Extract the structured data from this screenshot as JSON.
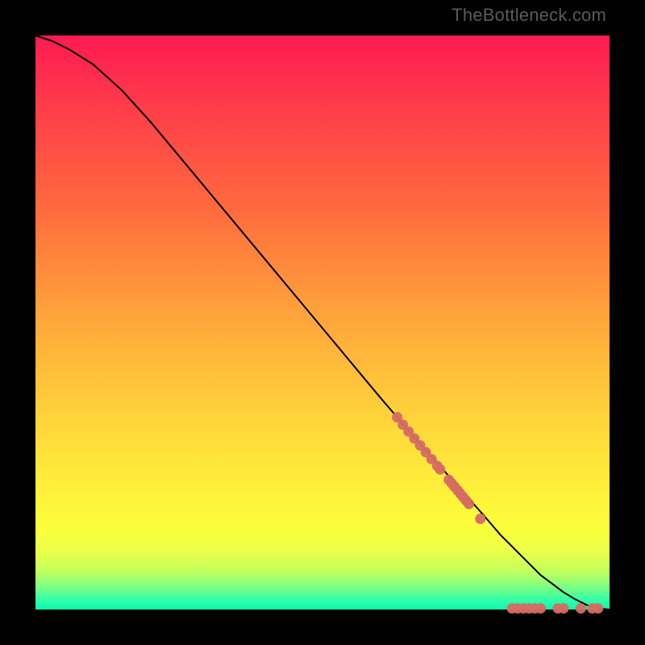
{
  "watermark": "TheBottleneck.com",
  "chart_data": {
    "type": "line",
    "title": "",
    "xlabel": "",
    "ylabel": "",
    "xlim": [
      0,
      100
    ],
    "ylim": [
      0,
      100
    ],
    "series": [
      {
        "name": "curve",
        "x": [
          0,
          3,
          6,
          10,
          15,
          20,
          30,
          40,
          50,
          60,
          66,
          70,
          74,
          78,
          81,
          84,
          86,
          88,
          90,
          92,
          94,
          96,
          98,
          100
        ],
        "y": [
          100,
          99,
          97.5,
          95,
          90.5,
          85,
          73,
          61,
          49,
          37,
          30,
          25.5,
          21,
          16.5,
          13,
          10,
          8,
          6,
          4.5,
          3,
          1.8,
          0.8,
          0.2,
          0
        ]
      }
    ],
    "markers": [
      {
        "x": 63,
        "y": 33.5
      },
      {
        "x": 64,
        "y": 32.2
      },
      {
        "x": 65,
        "y": 31
      },
      {
        "x": 66,
        "y": 29.8
      },
      {
        "x": 67,
        "y": 28.6
      },
      {
        "x": 68,
        "y": 27.4
      },
      {
        "x": 69,
        "y": 26.2
      },
      {
        "x": 70,
        "y": 25.0
      },
      {
        "x": 70.5,
        "y": 24.4
      },
      {
        "x": 72,
        "y": 22.6
      },
      {
        "x": 72.5,
        "y": 22.0
      },
      {
        "x": 73,
        "y": 21.4
      },
      {
        "x": 73.5,
        "y": 20.8
      },
      {
        "x": 74,
        "y": 20.2
      },
      {
        "x": 74.5,
        "y": 19.6
      },
      {
        "x": 75,
        "y": 19.0
      },
      {
        "x": 75.5,
        "y": 18.4
      },
      {
        "x": 77.5,
        "y": 15.8
      },
      {
        "x": 83,
        "y": 0.2
      },
      {
        "x": 84,
        "y": 0.2
      },
      {
        "x": 85,
        "y": 0.2
      },
      {
        "x": 86,
        "y": 0.2
      },
      {
        "x": 87,
        "y": 0.2
      },
      {
        "x": 88,
        "y": 0.2
      },
      {
        "x": 91,
        "y": 0.2
      },
      {
        "x": 92,
        "y": 0.2
      },
      {
        "x": 95,
        "y": 0.2
      },
      {
        "x": 97,
        "y": 0.2
      },
      {
        "x": 98,
        "y": 0.2
      }
    ],
    "marker_color": "#d66b63",
    "line_color": "#000000"
  }
}
